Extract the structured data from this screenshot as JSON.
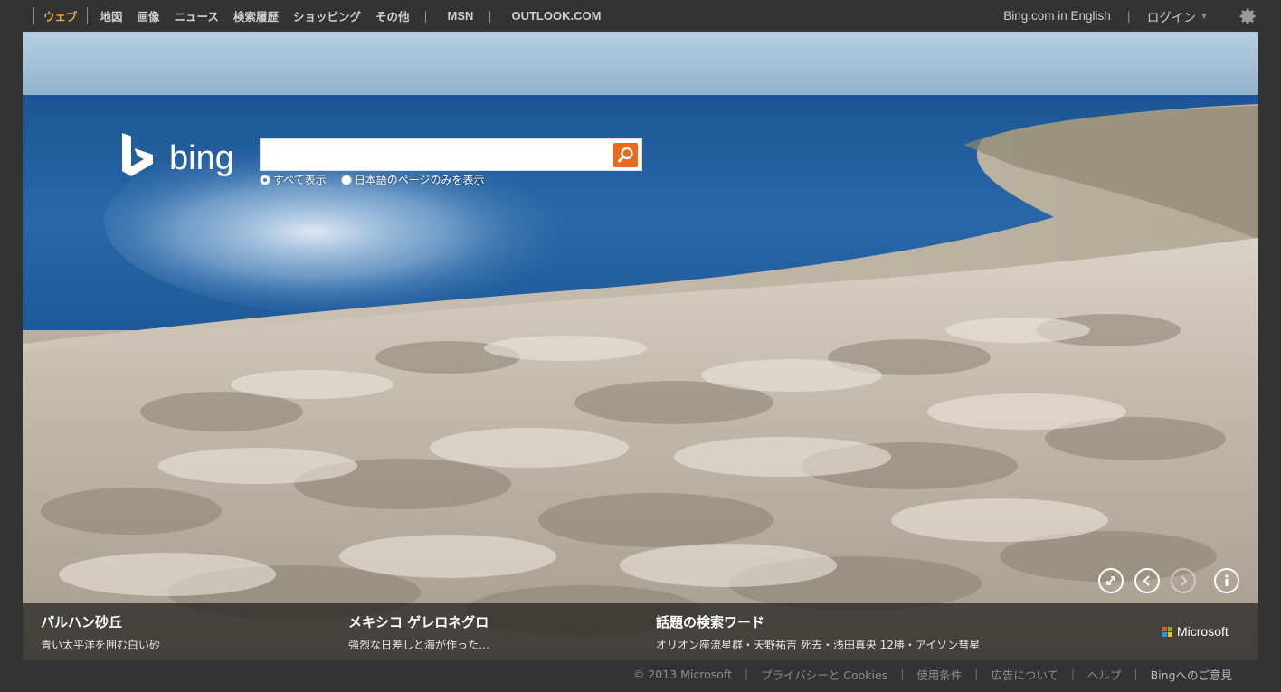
{
  "nav": {
    "items": [
      "ウェブ",
      "地図",
      "画像",
      "ニュース",
      "検索履歴",
      "ショッピング",
      "その他"
    ],
    "separator": "|",
    "msn": "MSN",
    "outlook": "OUTLOOK.COM"
  },
  "topright": {
    "english": "Bing.com in English",
    "separator": "|",
    "login": "ログイン",
    "login_caret": "▼",
    "settings_icon": "gear-icon"
  },
  "logo": {
    "text": "bing"
  },
  "search": {
    "value": "",
    "placeholder": "",
    "button_icon": "search-icon"
  },
  "scope": {
    "options": [
      {
        "label": "すべて表示",
        "selected": true
      },
      {
        "label": "日本語のページのみを表示",
        "selected": false
      }
    ]
  },
  "controls": [
    "expand-icon",
    "previous-icon",
    "next-icon",
    "info-icon"
  ],
  "infobar": {
    "blocks": [
      {
        "title": "パルハン砂丘",
        "subtitle": "青い太平洋を囲む白い砂"
      },
      {
        "title": "メキシコ ゲレロネグロ",
        "subtitle": "強烈な日差しと海が作った…"
      },
      {
        "title": "話題の検索ワード",
        "subtitle": "オリオン座流星群・天野祐吉 死去・浅田真央 12勝・アイソン彗星"
      }
    ],
    "brand": "Microsoft",
    "brand_colors": [
      "#f25022",
      "#7fba00",
      "#00a4ef",
      "#ffb900"
    ]
  },
  "footer": {
    "items": [
      "© 2013 Microsoft",
      "プライバシーと Cookies",
      "使用条件",
      "広告について",
      "ヘルプ",
      "Bingへのご意見"
    ],
    "separator": "|"
  },
  "colors": {
    "active_nav": "#f7a43a",
    "search_button": "#e86a1d",
    "background": "#333333"
  }
}
